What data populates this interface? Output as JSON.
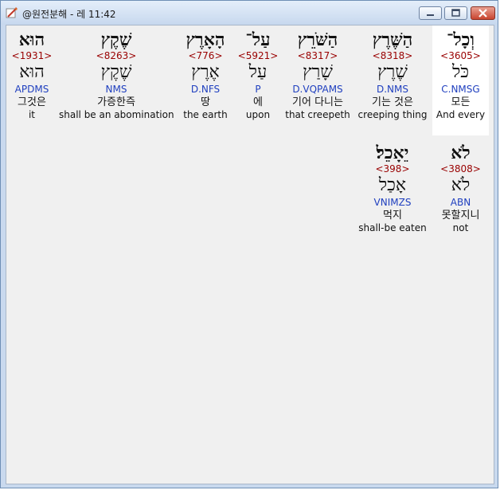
{
  "window": {
    "title": "@원전분해 - 레 11:42",
    "buttons": {
      "minimize": "minimize",
      "maximize": "maximize",
      "close": "close"
    }
  },
  "rows": [
    {
      "words": [
        {
          "hebrew": "הוּא",
          "strong": "<1931>",
          "lemma": "הוּא",
          "morph": "APDMS",
          "korean": "그것은",
          "english": "it"
        },
        {
          "hebrew": "שֶׁקֶץ",
          "strong": "<8263>",
          "lemma": "שֶׁקֶץ",
          "morph": "NMS",
          "korean": "가증한즉",
          "english": "shall be an abomination"
        },
        {
          "hebrew": "הָאָרֶץ",
          "strong": "<776>",
          "lemma": "אֶרֶץ",
          "morph": "D.NFS",
          "korean": "땅",
          "english": "the earth"
        },
        {
          "hebrew": "עַל־",
          "strong": "<5921>",
          "lemma": "עַל",
          "morph": "P",
          "korean": "에",
          "english": "upon"
        },
        {
          "hebrew": "הַשֹּׁרֵץ",
          "strong": "<8317>",
          "lemma": "שָׁרַץ",
          "morph": "D.VQPAMS",
          "korean": "기어 다니는",
          "english": "that creepeth"
        },
        {
          "hebrew": "הַשֶּׁרֶץ",
          "strong": "<8318>",
          "lemma": "שֶׁרֶץ",
          "morph": "D.NMS",
          "korean": "기는 것은",
          "english": "creeping thing"
        },
        {
          "hebrew": "וְכָל־",
          "strong": "<3605>",
          "lemma": "כֹּל",
          "morph": "C.NMSG",
          "korean": "모든",
          "english": "And every"
        }
      ]
    },
    {
      "words": [
        {
          "hebrew": "יֵאָכֵל׃",
          "strong": "<398>",
          "lemma": "אָכַל",
          "morph": "VNIMZS",
          "korean": "먹지",
          "english": "shall-be eaten"
        },
        {
          "hebrew": "לֹא",
          "strong": "<3808>",
          "lemma": "לֹא",
          "morph": "ABN",
          "korean": "못할지니",
          "english": "not"
        }
      ]
    }
  ]
}
